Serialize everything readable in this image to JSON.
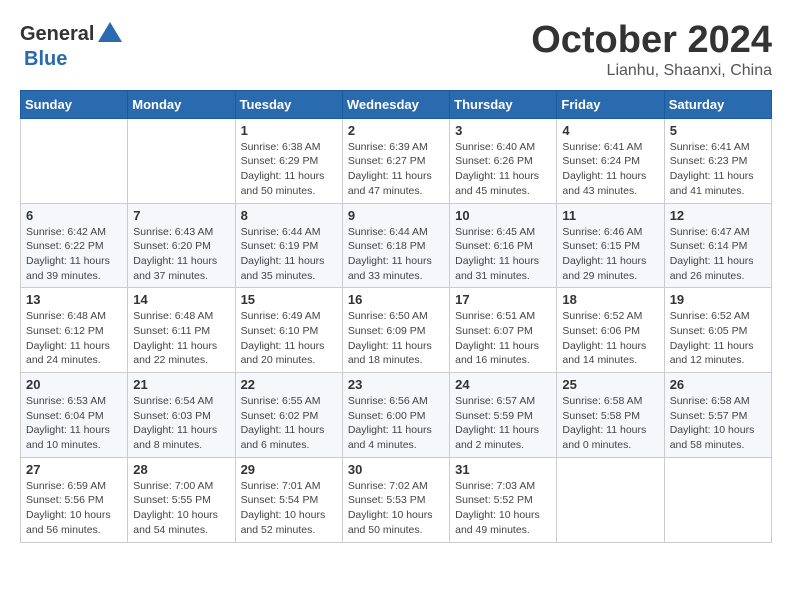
{
  "header": {
    "logo_general": "General",
    "logo_blue": "Blue",
    "month": "October 2024",
    "location": "Lianhu, Shaanxi, China"
  },
  "days_of_week": [
    "Sunday",
    "Monday",
    "Tuesday",
    "Wednesday",
    "Thursday",
    "Friday",
    "Saturday"
  ],
  "weeks": [
    [
      {
        "day": "",
        "info": ""
      },
      {
        "day": "",
        "info": ""
      },
      {
        "day": "1",
        "info": "Sunrise: 6:38 AM\nSunset: 6:29 PM\nDaylight: 11 hours and 50 minutes."
      },
      {
        "day": "2",
        "info": "Sunrise: 6:39 AM\nSunset: 6:27 PM\nDaylight: 11 hours and 47 minutes."
      },
      {
        "day": "3",
        "info": "Sunrise: 6:40 AM\nSunset: 6:26 PM\nDaylight: 11 hours and 45 minutes."
      },
      {
        "day": "4",
        "info": "Sunrise: 6:41 AM\nSunset: 6:24 PM\nDaylight: 11 hours and 43 minutes."
      },
      {
        "day": "5",
        "info": "Sunrise: 6:41 AM\nSunset: 6:23 PM\nDaylight: 11 hours and 41 minutes."
      }
    ],
    [
      {
        "day": "6",
        "info": "Sunrise: 6:42 AM\nSunset: 6:22 PM\nDaylight: 11 hours and 39 minutes."
      },
      {
        "day": "7",
        "info": "Sunrise: 6:43 AM\nSunset: 6:20 PM\nDaylight: 11 hours and 37 minutes."
      },
      {
        "day": "8",
        "info": "Sunrise: 6:44 AM\nSunset: 6:19 PM\nDaylight: 11 hours and 35 minutes."
      },
      {
        "day": "9",
        "info": "Sunrise: 6:44 AM\nSunset: 6:18 PM\nDaylight: 11 hours and 33 minutes."
      },
      {
        "day": "10",
        "info": "Sunrise: 6:45 AM\nSunset: 6:16 PM\nDaylight: 11 hours and 31 minutes."
      },
      {
        "day": "11",
        "info": "Sunrise: 6:46 AM\nSunset: 6:15 PM\nDaylight: 11 hours and 29 minutes."
      },
      {
        "day": "12",
        "info": "Sunrise: 6:47 AM\nSunset: 6:14 PM\nDaylight: 11 hours and 26 minutes."
      }
    ],
    [
      {
        "day": "13",
        "info": "Sunrise: 6:48 AM\nSunset: 6:12 PM\nDaylight: 11 hours and 24 minutes."
      },
      {
        "day": "14",
        "info": "Sunrise: 6:48 AM\nSunset: 6:11 PM\nDaylight: 11 hours and 22 minutes."
      },
      {
        "day": "15",
        "info": "Sunrise: 6:49 AM\nSunset: 6:10 PM\nDaylight: 11 hours and 20 minutes."
      },
      {
        "day": "16",
        "info": "Sunrise: 6:50 AM\nSunset: 6:09 PM\nDaylight: 11 hours and 18 minutes."
      },
      {
        "day": "17",
        "info": "Sunrise: 6:51 AM\nSunset: 6:07 PM\nDaylight: 11 hours and 16 minutes."
      },
      {
        "day": "18",
        "info": "Sunrise: 6:52 AM\nSunset: 6:06 PM\nDaylight: 11 hours and 14 minutes."
      },
      {
        "day": "19",
        "info": "Sunrise: 6:52 AM\nSunset: 6:05 PM\nDaylight: 11 hours and 12 minutes."
      }
    ],
    [
      {
        "day": "20",
        "info": "Sunrise: 6:53 AM\nSunset: 6:04 PM\nDaylight: 11 hours and 10 minutes."
      },
      {
        "day": "21",
        "info": "Sunrise: 6:54 AM\nSunset: 6:03 PM\nDaylight: 11 hours and 8 minutes."
      },
      {
        "day": "22",
        "info": "Sunrise: 6:55 AM\nSunset: 6:02 PM\nDaylight: 11 hours and 6 minutes."
      },
      {
        "day": "23",
        "info": "Sunrise: 6:56 AM\nSunset: 6:00 PM\nDaylight: 11 hours and 4 minutes."
      },
      {
        "day": "24",
        "info": "Sunrise: 6:57 AM\nSunset: 5:59 PM\nDaylight: 11 hours and 2 minutes."
      },
      {
        "day": "25",
        "info": "Sunrise: 6:58 AM\nSunset: 5:58 PM\nDaylight: 11 hours and 0 minutes."
      },
      {
        "day": "26",
        "info": "Sunrise: 6:58 AM\nSunset: 5:57 PM\nDaylight: 10 hours and 58 minutes."
      }
    ],
    [
      {
        "day": "27",
        "info": "Sunrise: 6:59 AM\nSunset: 5:56 PM\nDaylight: 10 hours and 56 minutes."
      },
      {
        "day": "28",
        "info": "Sunrise: 7:00 AM\nSunset: 5:55 PM\nDaylight: 10 hours and 54 minutes."
      },
      {
        "day": "29",
        "info": "Sunrise: 7:01 AM\nSunset: 5:54 PM\nDaylight: 10 hours and 52 minutes."
      },
      {
        "day": "30",
        "info": "Sunrise: 7:02 AM\nSunset: 5:53 PM\nDaylight: 10 hours and 50 minutes."
      },
      {
        "day": "31",
        "info": "Sunrise: 7:03 AM\nSunset: 5:52 PM\nDaylight: 10 hours and 49 minutes."
      },
      {
        "day": "",
        "info": ""
      },
      {
        "day": "",
        "info": ""
      }
    ]
  ]
}
